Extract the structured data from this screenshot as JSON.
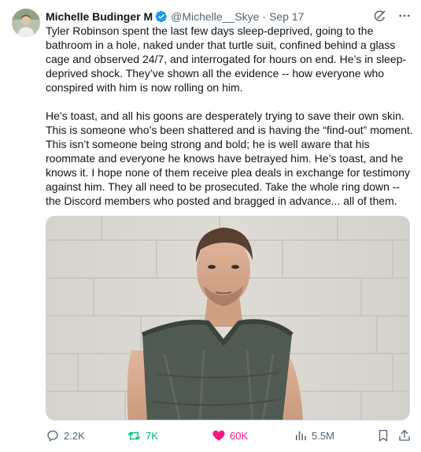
{
  "author": {
    "display_name": "Michelle Budinger M",
    "handle": "@Michelle__Skye",
    "separator": "·",
    "date": "Sep 17",
    "verified_color": "#1d9bf0"
  },
  "icons": {
    "avatar": "profile-photo",
    "verified": "verified-badge-icon",
    "grok": "grok-icon",
    "more": "more-icon",
    "reply": "reply-icon",
    "repost": "repost-icon",
    "like": "heart-icon",
    "views": "analytics-icon",
    "bookmark": "bookmark-icon",
    "share": "share-icon"
  },
  "body": {
    "paragraph_1": "Tyler Robinson spent the last few days sleep-deprived, going to the bathroom in a hole, naked under that turtle suit, confined behind a glass cage and observed 24/7, and interrogated for hours on end. He’s in sleep-deprived shock. They’ve shown all the evidence -- how everyone who conspired with him is now rolling on him.",
    "paragraph_2": "He’s toast, and all his goons are desperately trying to save their own skin. This is someone who’s been shattered and is having the “find-out” moment. This isn’t someone being strong and bold; he is well aware that his roommate and everyone he knows have betrayed him. He’s toast, and he knows it. I hope none of them receive plea deals in exchange for testimony against him. They all need to be prosecuted. Take the whole ring down -- the Discord members who posted and bragged in advance... all of them."
  },
  "stats": {
    "replies": "2.2K",
    "reposts": "7K",
    "likes": "60K",
    "views": "5.5M"
  },
  "colors": {
    "text_primary": "#0f1419",
    "text_secondary": "#536471",
    "repost_active": "#00ba7c",
    "like_active": "#f91880",
    "border": "#cfd9de"
  }
}
